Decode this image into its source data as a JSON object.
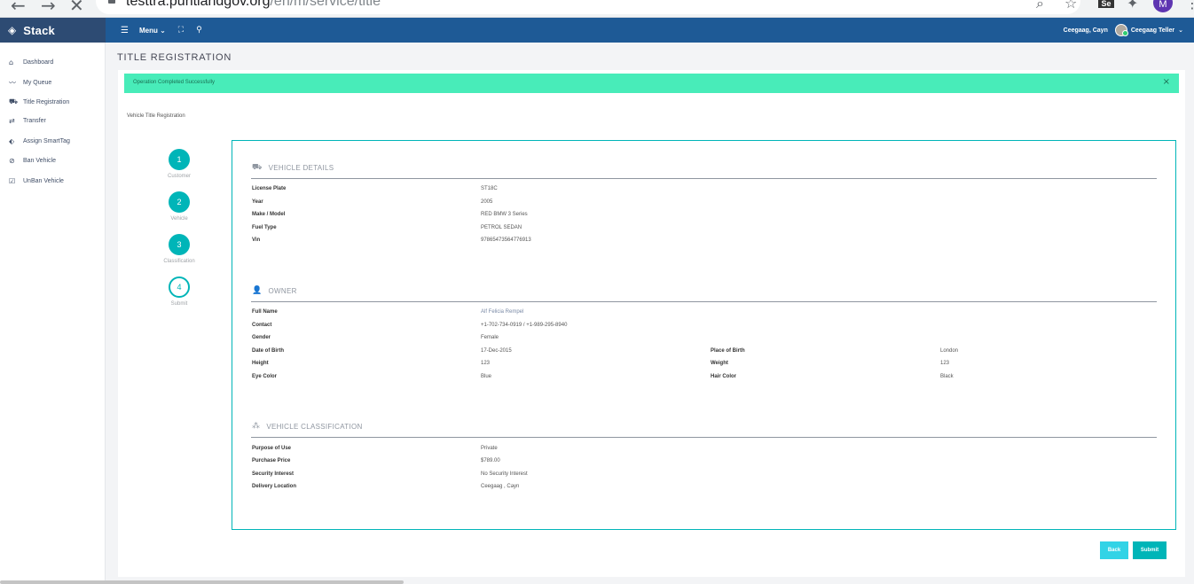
{
  "browser": {
    "url_host": "testtra.puntlandgov.org",
    "url_path": "/en/m/service/title",
    "profile_initial": "M",
    "ext_label": "Se"
  },
  "navbar": {
    "brand": "Stack",
    "menu_label": "Menu",
    "branch": "Ceegaag, Cayn",
    "user": "Ceegaag Teller"
  },
  "sidebar": {
    "items": [
      {
        "label": "Dashboard",
        "icon": "home-icon"
      },
      {
        "label": "My Queue",
        "icon": "trend-line-icon"
      },
      {
        "label": "Title Registration",
        "icon": "car-icon"
      },
      {
        "label": "Transfer",
        "icon": "transfer-icon"
      },
      {
        "label": "Assign SmartTag",
        "icon": "tag-icon"
      },
      {
        "label": "Ban Vehicle",
        "icon": "ban-icon"
      },
      {
        "label": "UnBan Vehicle",
        "icon": "checkbox-icon"
      }
    ]
  },
  "page": {
    "title": "TITLE REGISTRATION",
    "alert": "Operation Completed Successfully",
    "form_title": "Vehicle Title Registration"
  },
  "steps": [
    {
      "number": "1",
      "label": "Customer",
      "state": "done"
    },
    {
      "number": "2",
      "label": "Vehicle",
      "state": "done"
    },
    {
      "number": "3",
      "label": "Classification",
      "state": "done"
    },
    {
      "number": "4",
      "label": "Submit",
      "state": "current"
    }
  ],
  "vehicle": {
    "title": "VEHICLE DETAILS",
    "fields": [
      {
        "label": "License Plate",
        "value": "ST18C"
      },
      {
        "label": "Year",
        "value": "2005"
      },
      {
        "label": "Make / Model",
        "value": "RED BMW 3 Series"
      },
      {
        "label": "Fuel Type",
        "value": "PETROL SEDAN"
      },
      {
        "label": "Vin",
        "value": "97865473564776913"
      }
    ]
  },
  "owner": {
    "title": "OWNER",
    "full_name_label": "Full Name",
    "full_name": "Alf Felicia Rempel",
    "contact_label": "Contact",
    "contact": "+1-702-734-0919 / +1-989-295-8940",
    "gender_label": "Gender",
    "gender": "Female",
    "dob_label": "Date of Birth",
    "dob": "17-Dec-2015",
    "pob_label": "Place of Birth",
    "pob": "London",
    "height_label": "Height",
    "height": "123",
    "weight_label": "Weight",
    "weight": "123",
    "eye_label": "Eye Color",
    "eye": "Blue",
    "hair_label": "Hair Color",
    "hair": "Black"
  },
  "classification": {
    "title": "VEHICLE CLASSIFICATION",
    "fields": [
      {
        "label": "Purpose of Use",
        "value": "Private"
      },
      {
        "label": "Purchase Price",
        "value": "$789.00"
      },
      {
        "label": "Security Interest",
        "value": "No Security Interest"
      },
      {
        "label": "Delivery Location",
        "value": "Ceegaag , Cayn"
      }
    ]
  },
  "buttons": {
    "back": "Back",
    "submit": "Submit"
  },
  "colors": {
    "navbar": "#1e5a96",
    "brand_bg": "#2d4b73",
    "accent": "#00b5b8",
    "alert": "#48ecb9"
  }
}
